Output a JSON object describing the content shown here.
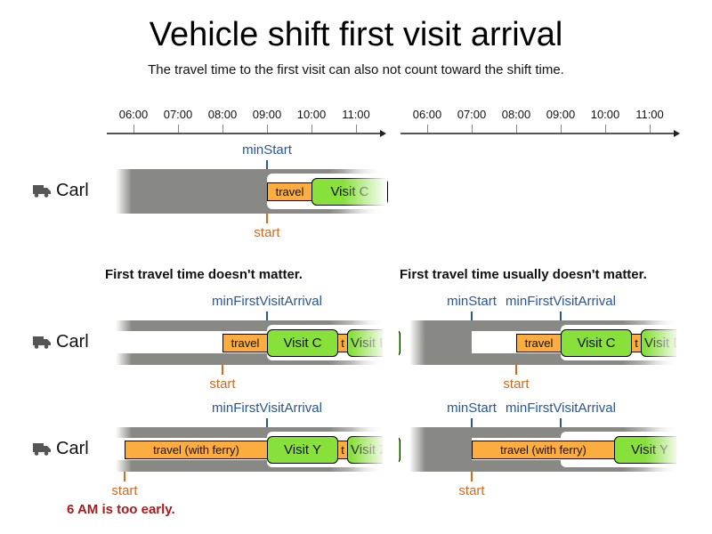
{
  "title": "Vehicle shift first visit arrival",
  "subtitle": "The travel time to the first visit can also not count toward the shift time.",
  "axes": {
    "left": {
      "ticks": [
        "06:00",
        "07:00",
        "08:00",
        "09:00",
        "10:00",
        "11:00"
      ]
    },
    "right": {
      "ticks": [
        "06:00",
        "07:00",
        "08:00",
        "09:00",
        "10:00",
        "11:00"
      ]
    }
  },
  "vehicle_icon": "truck-icon",
  "vehicle_name": "Carl",
  "top_panel": {
    "min_start_label": "minStart",
    "start_label": "start",
    "travel_label": "travel",
    "visit_label": "Visit C"
  },
  "middle_left": {
    "heading": "First travel time doesn't matter.",
    "min_first_visit_arrival_label": "minFirstVisitArrival",
    "start_label": "start",
    "travel_label": "travel",
    "visit_label": "Visit C",
    "short_travel_label": "t",
    "next_visit_label": "Visit D"
  },
  "middle_right": {
    "heading": "First travel time usually doesn't matter.",
    "min_start_label": "minStart",
    "min_first_visit_arrival_label": "minFirstVisitArrival",
    "start_label": "start",
    "travel_label": "travel",
    "visit_label": "Visit C",
    "short_travel_label": "t",
    "next_visit_label": "Visit D"
  },
  "bottom_left": {
    "min_first_visit_arrival_label": "minFirstVisitArrival",
    "start_label": "start",
    "travel_label": "travel (with ferry)",
    "visit_label": "Visit Y",
    "short_travel_label": "t",
    "next_visit_label": "Visit Z",
    "warning": "6 AM is too early."
  },
  "bottom_right": {
    "min_start_label": "minStart",
    "min_first_visit_arrival_label": "minFirstVisitArrival",
    "start_label": "start",
    "travel_label": "travel (with ferry)",
    "visit_label": "Visit Y"
  },
  "colors": {
    "travel": "#fbad3f",
    "visit": "#88e03b",
    "shift_unavailable": "#888984",
    "constraint_marker": "#2a5599",
    "start_marker": "#d8691b",
    "warning": "#a81b1b"
  }
}
